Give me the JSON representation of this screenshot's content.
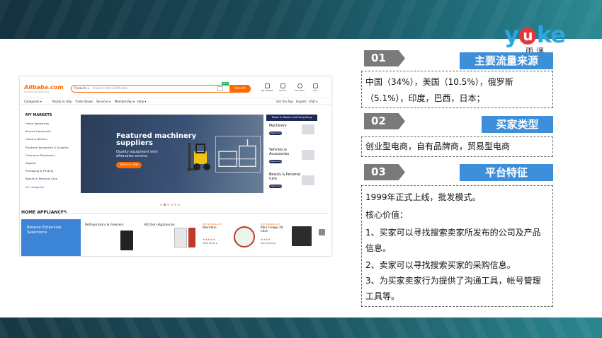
{
  "logo": {
    "word_a": "y",
    "word_u": "u",
    "word_b": "ke",
    "sub": "雨课"
  },
  "alibaba": {
    "logo": "Alibaba.com",
    "logo_tagline": "Global trade starts here",
    "search_category": "Products ▾",
    "search_placeholder": "Product with Certificates",
    "search_button": "Search",
    "new_badge": "NEW",
    "header_icons": [
      {
        "icon": "user-icon",
        "label": "My Alibaba"
      },
      {
        "icon": "orders-icon",
        "label": "Orders"
      },
      {
        "icon": "heart-icon",
        "label": "Favorites"
      },
      {
        "icon": "cart-icon",
        "label": "Cart"
      }
    ],
    "nav": [
      "Categories ▾",
      "Ready to Ship",
      "Trade Shows",
      "Services ▾",
      "Membership ▾",
      "Help ▾",
      "Get the App",
      "English - USD ▾"
    ],
    "markets_title": "MY MARKETS",
    "markets": [
      "Home Appliances",
      "Service Equipment",
      "Home & Kitchen",
      "Electrical Equipment & Supplies",
      "Consumer Electronics",
      "Apparel",
      "Packaging & Printing",
      "Beauty & Personal Care",
      "All Categories"
    ],
    "banner": {
      "headline_1": "Featured machinery",
      "headline_2": "suppliers",
      "sub_1": "Quality equipment with",
      "sub_2": "aftersales service",
      "button": "Source now"
    },
    "side": {
      "tag": "Made in Taiwan and Hong Kong",
      "items": [
        {
          "label_1": "Machinery",
          "label_2": "",
          "view": "View more"
        },
        {
          "label_1": "Vehicles &",
          "label_2": "Accessories",
          "view": "View more"
        },
        {
          "label_1": "Beauty & Personal",
          "label_2": "Care",
          "view": "View more"
        }
      ]
    },
    "section_title": "HOME APPLIANCES",
    "blue_card_1": "Browse Extensive",
    "blue_card_2": "Selections",
    "cards": [
      {
        "title": "Refrigerators & Freezers"
      },
      {
        "title": "Kitchen Appliances"
      }
    ],
    "hot_cards": [
      {
        "hot": "HOT SELLING LIST",
        "title_1": "Blenders",
        "title_2": "",
        "stars": "★★★★★",
        "view": "View More ▸"
      },
      {
        "hot": "HOT SELLING LIST",
        "title_1": "Mini Fridge 20",
        "title_2": "Litre",
        "stars": "★★★★",
        "view": "View More ▸"
      }
    ]
  },
  "sections": [
    {
      "num": "01",
      "title": "主要流量来源",
      "lines": [
        "中国（34%），美国（10.5%），俄罗斯",
        "（5.1%），印度，巴西，日本；"
      ]
    },
    {
      "num": "02",
      "title": "买家类型",
      "lines": [
        "创业型电商，自有品牌商，贸易型电商"
      ]
    },
    {
      "num": "03",
      "title": "平台特征",
      "lines": [
        "1999年正式上线，批发模式。",
        "核心价值：",
        "1、买家可以寻找搜索卖家所发布的公司及产品",
        "信息。",
        "2、卖家可以寻找搜索买家的采购信息。",
        "3、为买家卖家行为提供了沟通工具，帐号管理",
        "工具等。"
      ]
    }
  ],
  "colors": {
    "accent_blue": "#3e8fd9",
    "badge_gray": "#7a7a7a",
    "alibaba_orange": "#ff6a00"
  }
}
